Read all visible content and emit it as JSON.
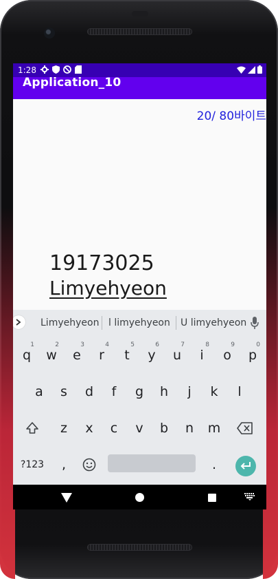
{
  "status": {
    "time": "1:28"
  },
  "app": {
    "title": "Application_10"
  },
  "content": {
    "byte_counter": "20/ 80바이트",
    "number_text": "19173025",
    "name_text": "Limyehyeon"
  },
  "keyboard": {
    "suggestions": [
      "Limyehyeon",
      "l limyehyeon",
      "U limyehyeon"
    ],
    "row1": [
      "q",
      "w",
      "e",
      "r",
      "t",
      "y",
      "u",
      "i",
      "o",
      "p"
    ],
    "row1_hints": [
      "1",
      "2",
      "3",
      "4",
      "5",
      "6",
      "7",
      "8",
      "9",
      "0"
    ],
    "row2": [
      "a",
      "s",
      "d",
      "f",
      "g",
      "h",
      "j",
      "k",
      "l"
    ],
    "row3": [
      "z",
      "x",
      "c",
      "v",
      "b",
      "n",
      "m"
    ],
    "symbols_label": "?123",
    "comma": ",",
    "period": "."
  },
  "colors": {
    "statusbar": "#3700b3",
    "appbar": "#6200ee",
    "counter": "#2222dd",
    "enter": "#4db6ac"
  },
  "icons": [
    "gear-icon",
    "shield-icon",
    "no-entry-icon",
    "sim-card-icon",
    "wifi-icon",
    "signal-icon",
    "battery-icon",
    "mic-icon",
    "shift-icon",
    "backspace-icon",
    "emoji-icon",
    "enter-icon",
    "back-icon",
    "home-icon",
    "recents-icon",
    "keyboard-switch-icon"
  ]
}
